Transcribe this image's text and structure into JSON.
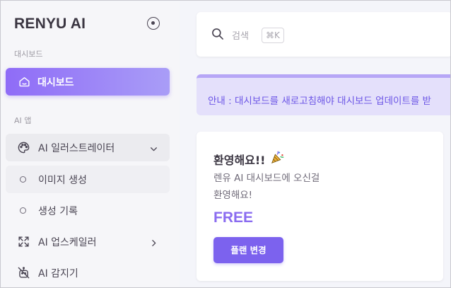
{
  "brand": {
    "name": "RENYU AI"
  },
  "sidebar": {
    "section_dashboard": "대시보드",
    "active_item": "대시보드",
    "section_apps": "AI 앱",
    "items": [
      {
        "label": "AI 일러스트레이터",
        "icon": "palette-icon",
        "expanded": true
      },
      {
        "label": "이미지 생성",
        "icon": "circle-icon"
      },
      {
        "label": "생성 기록",
        "icon": "circle-icon"
      },
      {
        "label": "AI 업스케일러",
        "icon": "expand-icon"
      },
      {
        "label": "AI 감지기",
        "icon": "robot-off-icon"
      }
    ]
  },
  "search": {
    "placeholder": "검색",
    "shortcut": "⌘K"
  },
  "notice": {
    "text": "안내 : 대시보드를 새로고침해야 대시보드 업데이트를 받"
  },
  "welcome": {
    "title": "환영해요!!",
    "line1": "렌유 AI 대시보드에 오신걸",
    "line2": "환영해요!",
    "plan": "FREE",
    "button": "플랜 변경"
  },
  "colors": {
    "accent": "#7c62ee",
    "notice_bg": "#e4e0fb",
    "notice_text": "#6b55e6"
  }
}
